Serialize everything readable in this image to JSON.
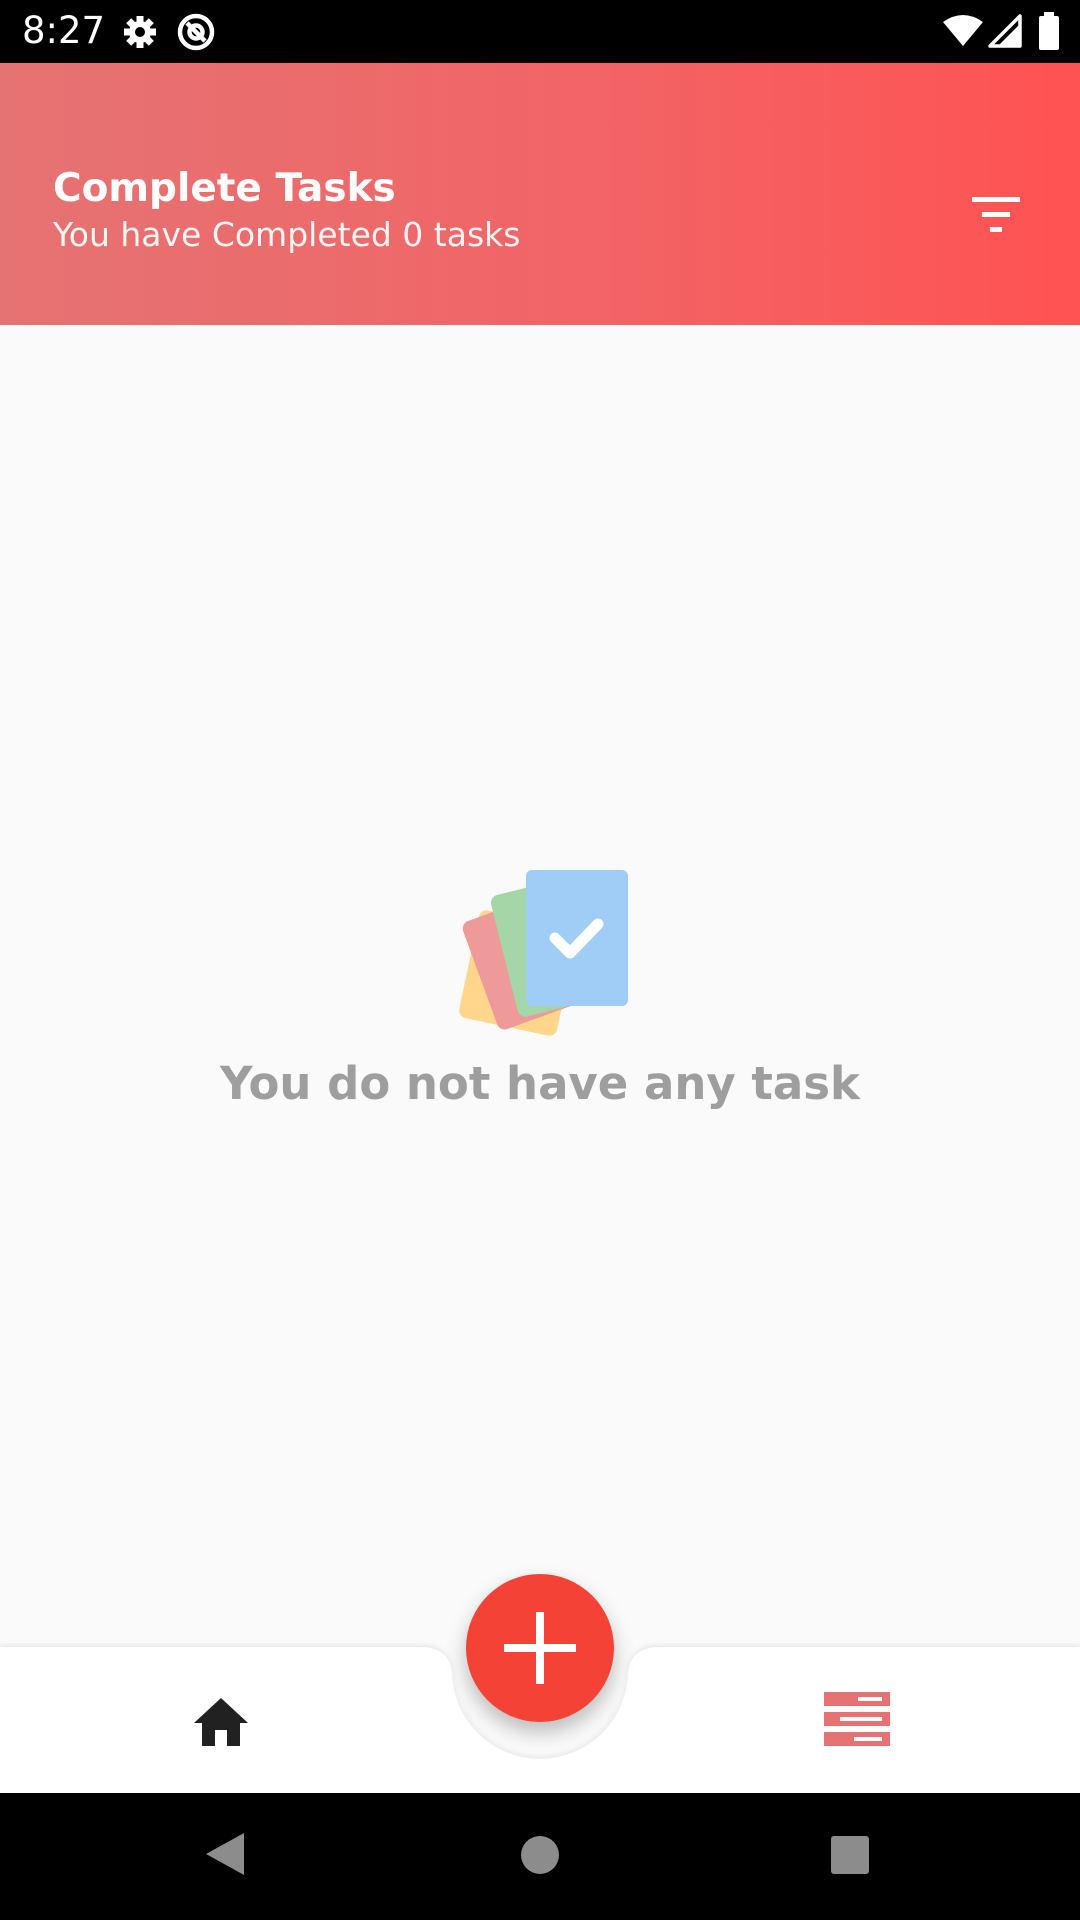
{
  "status_bar": {
    "time": "8:27",
    "icons": [
      "gear-icon",
      "at-sign-icon",
      "wifi-icon",
      "signal-icon",
      "battery-icon"
    ]
  },
  "header": {
    "title": "Complete Tasks",
    "subtitle": "You have Completed 0 tasks",
    "gradient": [
      "#e57373",
      "#ff5252"
    ],
    "action_icon": "filter-icon"
  },
  "empty_state": {
    "illustration": "stacked-task-cards-with-check",
    "message": "You do not have any task"
  },
  "bottom_nav": {
    "items": [
      {
        "icon": "home-icon",
        "color": "#212121"
      },
      {
        "icon": "task-list-icon",
        "color": "#e57373"
      }
    ],
    "fab": {
      "icon": "plus-icon",
      "color": "#f44336"
    }
  },
  "system_nav": {
    "buttons": [
      "back-icon",
      "home-circle-icon",
      "recents-icon"
    ]
  }
}
